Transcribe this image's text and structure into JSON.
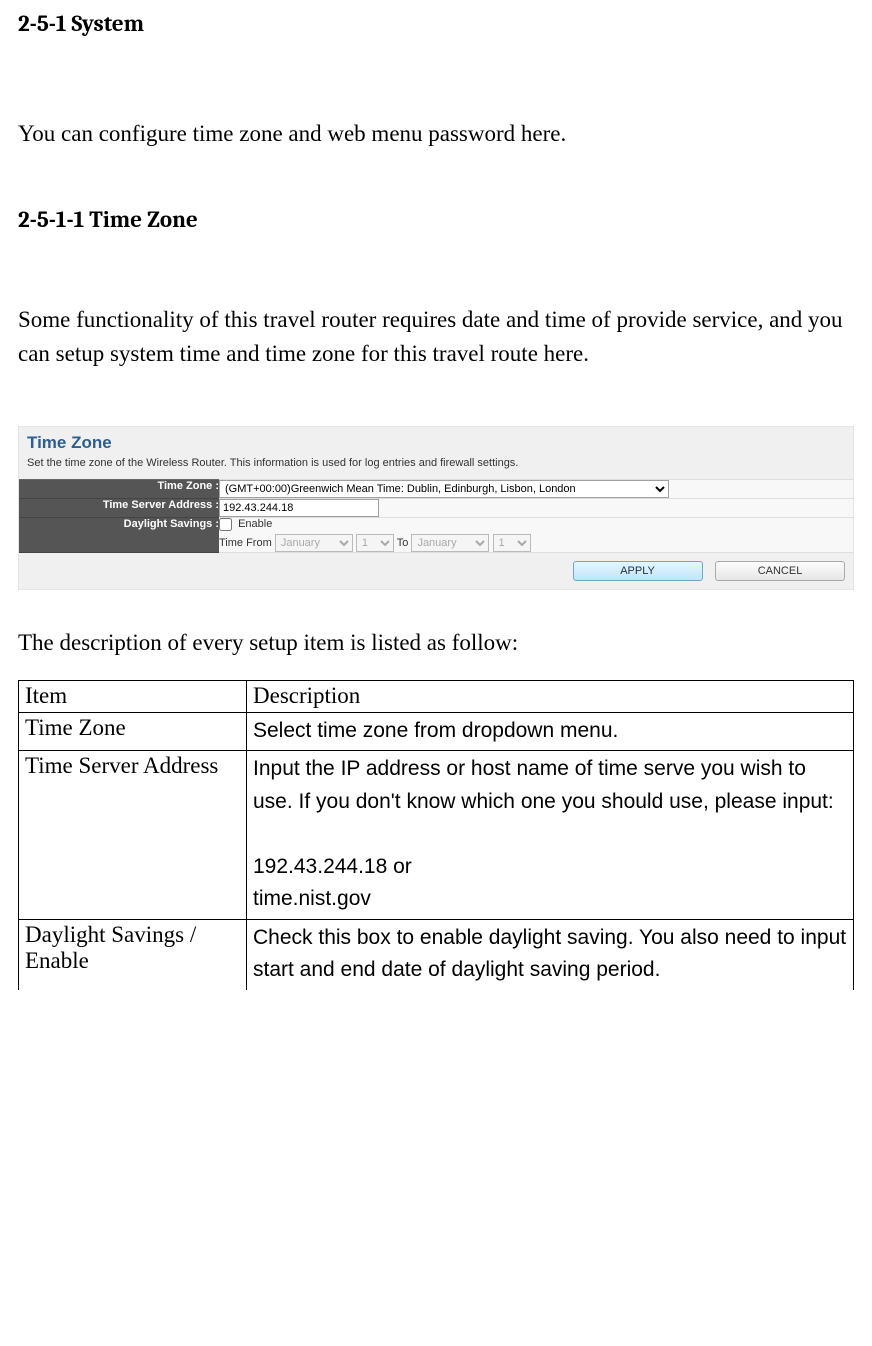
{
  "headings": {
    "main": "2-5-1 System",
    "sub": "2-5-1-1 Time Zone"
  },
  "paragraphs": {
    "intro": "You can configure time zone and web menu password here.",
    "subintro": "Some functionality of this travel router requires date and time of provide service, and you can setup system time and time zone for this travel route here.",
    "desc_intro": "The description of every setup item is listed as follow:"
  },
  "panel": {
    "title": "Time Zone",
    "subtitle": "Set the time zone of the Wireless Router. This information is used for log entries and firewall settings.",
    "rows": {
      "time_zone": {
        "label": "Time Zone :",
        "value": "(GMT+00:00)Greenwich Mean Time: Dublin, Edinburgh, Lisbon, London"
      },
      "time_server": {
        "label": "Time Server Address :",
        "value": "192.43.244.18"
      },
      "dst": {
        "label": "Daylight Savings :",
        "enable": "Enable",
        "time_from": "Time From",
        "to": "To",
        "month1": "January",
        "day1": "1",
        "month2": "January",
        "day2": "1"
      }
    },
    "buttons": {
      "apply": "APPLY",
      "cancel": "CANCEL"
    }
  },
  "desc_table": {
    "headers": {
      "item": "Item",
      "description": "Description"
    },
    "rows": [
      {
        "item": "Time Zone",
        "desc": "Select time zone from dropdown menu."
      },
      {
        "item": "Time Server Address",
        "desc": "Input the IP address or host name of time serve you wish to use. If you don't know which one you should use, please input:\n\n192.43.244.18 or\ntime.nist.gov"
      },
      {
        "item": "Daylight Savings / Enable",
        "desc": "Check this box to enable daylight saving. You also need to input start and end date of daylight saving period."
      }
    ]
  }
}
